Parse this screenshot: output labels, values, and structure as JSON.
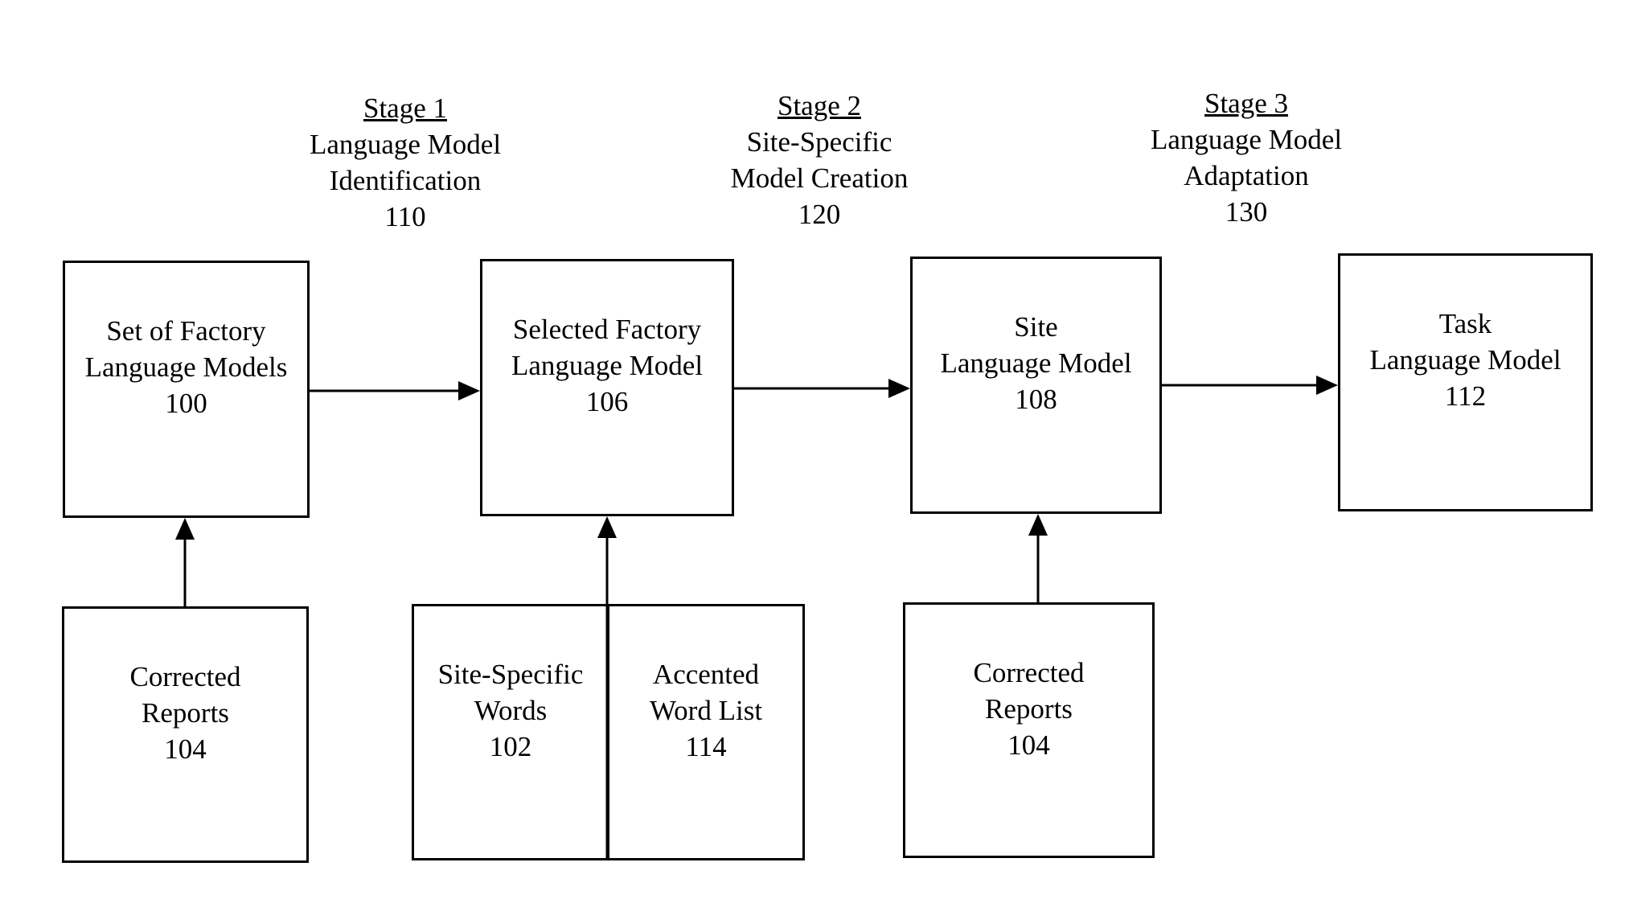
{
  "stages": [
    {
      "title": "Stage 1",
      "lines": [
        "Language Model",
        "Identification"
      ],
      "ref": "110"
    },
    {
      "title": "Stage 2",
      "lines": [
        "Site-Specific",
        "Model Creation"
      ],
      "ref": "120"
    },
    {
      "title": "Stage 3",
      "lines": [
        "Language Model",
        "Adaptation"
      ],
      "ref": "130"
    }
  ],
  "boxes": {
    "factory_set": {
      "lines": [
        "Set of Factory",
        "Language Models"
      ],
      "ref": "100"
    },
    "selected_factory": {
      "lines": [
        "Selected Factory",
        "Language Model"
      ],
      "ref": "106"
    },
    "site_model": {
      "lines": [
        "Site",
        "Language Model"
      ],
      "ref": "108"
    },
    "task_model": {
      "lines": [
        "Task",
        "Language Model"
      ],
      "ref": "112"
    },
    "corrected_reports_1": {
      "lines": [
        "Corrected",
        "Reports"
      ],
      "ref": "104"
    },
    "site_specific_words": {
      "lines": [
        "Site-Specific",
        "Words"
      ],
      "ref": "102"
    },
    "accented_word_list": {
      "lines": [
        "Accented",
        "Word List"
      ],
      "ref": "114"
    },
    "corrected_reports_2": {
      "lines": [
        "Corrected",
        "Reports"
      ],
      "ref": "104"
    }
  },
  "edges": [
    {
      "from": "factory_set",
      "to": "selected_factory"
    },
    {
      "from": "selected_factory",
      "to": "site_model"
    },
    {
      "from": "site_model",
      "to": "task_model"
    },
    {
      "from": "corrected_reports_1",
      "to": "factory_set"
    },
    {
      "from": "site_specific_words+accented_word_list",
      "to": "selected_factory"
    },
    {
      "from": "corrected_reports_2",
      "to": "site_model"
    }
  ]
}
